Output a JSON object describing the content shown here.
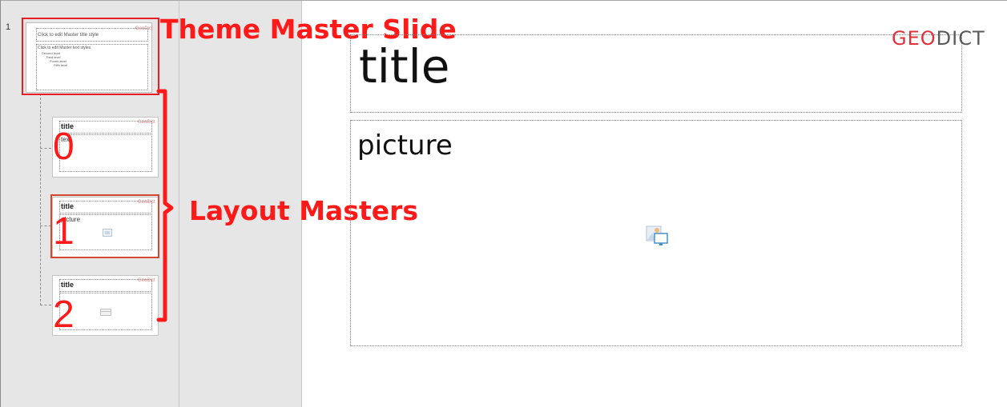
{
  "thumbnail_pane": {
    "slide_number": "1",
    "master_thumbnail": {
      "title_placeholder": "Click to edit Master title style",
      "text_placeholder": "Click to edit Master text styles",
      "levels": [
        "Second level",
        "Third level",
        "Fourth level",
        "Fifth level"
      ],
      "logo": "GeoDict"
    },
    "layouts": [
      {
        "number": "0",
        "title": "title",
        "body": "text",
        "logo": "GeoDict"
      },
      {
        "number": "1",
        "title": "title",
        "body": "picture",
        "logo": "GeoDict"
      },
      {
        "number": "2",
        "title": "title",
        "body": "",
        "logo": "GeoDict"
      }
    ]
  },
  "annotations": {
    "theme_master": "Theme Master Slide",
    "layout_masters": "Layout Masters"
  },
  "slide": {
    "title_placeholder": "title",
    "picture_placeholder": "picture",
    "logo_geo": "GEO",
    "logo_dict": "DICT",
    "picture_icon": "insert-picture-icon"
  },
  "colors": {
    "annotation_red": "#ff1a1a",
    "selection_orange": "#d4462d",
    "logo_red": "#e0303a",
    "logo_gray": "#5a5a5a"
  }
}
